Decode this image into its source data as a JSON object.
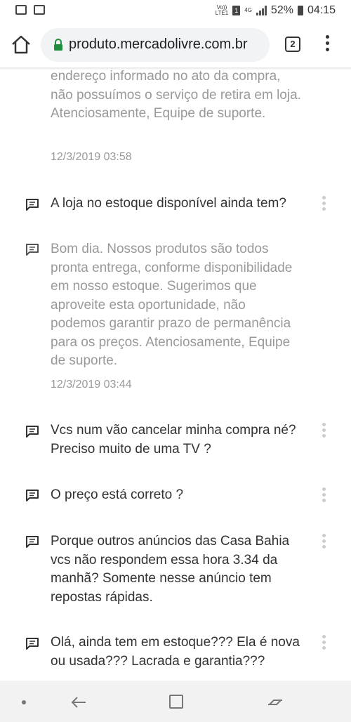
{
  "status_bar": {
    "network_label_top": "Vo))",
    "network_label_bottom": "LTE1",
    "sim": "1",
    "signal_type": "4G",
    "battery": "52%",
    "time": "04:15"
  },
  "browser": {
    "url": "produto.mercadolivre.com.br",
    "tab_count": "2"
  },
  "qa": [
    {
      "answer_fragment": "endereço informado no ato da compra, não possuímos o serviço de retira em loja. Atenciosamente, Equipe de suporte.",
      "date": "12/3/2019 03:58"
    },
    {
      "question": "A loja no estoque disponível ainda tem?",
      "answer": "Bom dia. Nossos produtos são todos pronta entrega, conforme disponibilidade em nosso estoque. Sugerimos que aproveite esta oportunidade, não podemos garantir prazo de permanência para os preços. Atenciosamente, Equipe de suporte.",
      "date": "12/3/2019 03:44"
    },
    {
      "question": "Vcs num vão cancelar minha compra né? Preciso muito de uma TV ?"
    },
    {
      "question": "O preço está correto ?"
    },
    {
      "question": "Porque outros anúncios das Casa Bahia vcs não respondem essa hora 3.34 da manhã? Somente nesse anúncio tem repostas rápidas."
    },
    {
      "question": "Olá, ainda tem em estoque??? Ela é nova ou usada??? Lacrada e garantia???"
    }
  ]
}
